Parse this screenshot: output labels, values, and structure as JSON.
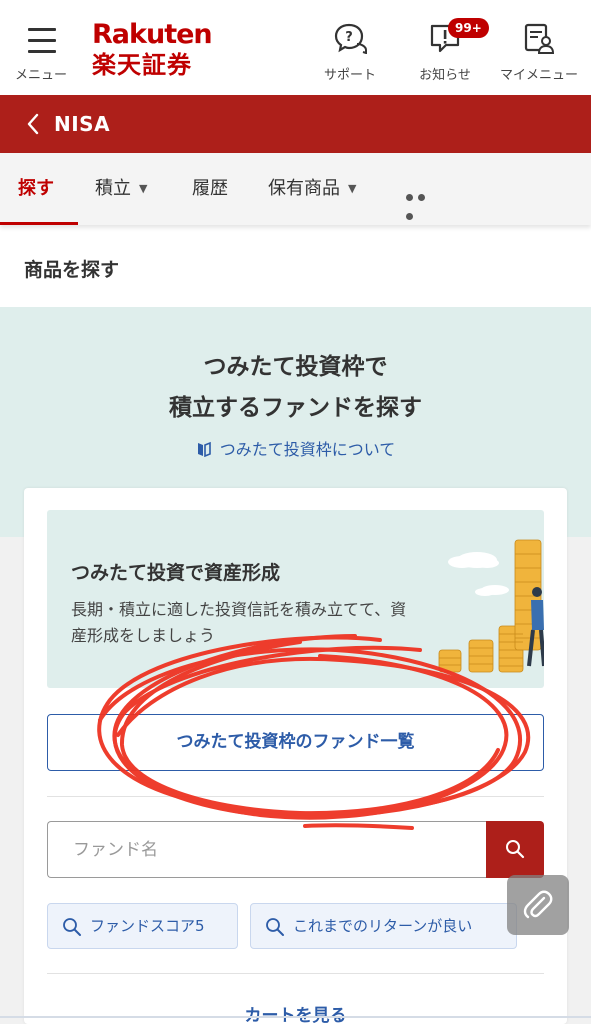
{
  "header": {
    "menu_label": "メニュー",
    "logo_en": "Rakuten",
    "logo_ja": "楽天証券",
    "support_label": "サポート",
    "news_label": "お知らせ",
    "news_badge": "99+",
    "mymenu_label": "マイメニュー"
  },
  "nisa_bar": {
    "title": "NISA"
  },
  "tabs": [
    {
      "label": "探す",
      "active": true
    },
    {
      "label": "積立",
      "dropdown": true
    },
    {
      "label": "履歴"
    },
    {
      "label": "保有商品",
      "dropdown": true
    },
    {
      "label": "•••"
    }
  ],
  "section_title": "商品を探す",
  "hero": {
    "line1": "つみたて投資枠で",
    "line2": "積立するファンドを探す",
    "about_link": "つみたて投資枠について"
  },
  "promo": {
    "title": "つみたて投資で資産形成",
    "text": "長期・積立に適した投資信託を積み立てて、資産形成をしましょう"
  },
  "fund_list_button": "つみたて投資枠のファンド一覧",
  "search": {
    "placeholder": "ファンド名"
  },
  "chips": [
    {
      "label": "ファンドスコア5"
    },
    {
      "label": "これまでのリターンが良い"
    }
  ],
  "cart_link": "カートを見る",
  "colors": {
    "brand_red": "#bf0000",
    "bar_red": "#ad1f1a",
    "link_blue": "#2d5ca8",
    "mint": "#dfeeec",
    "annotation": "#ee3322"
  }
}
